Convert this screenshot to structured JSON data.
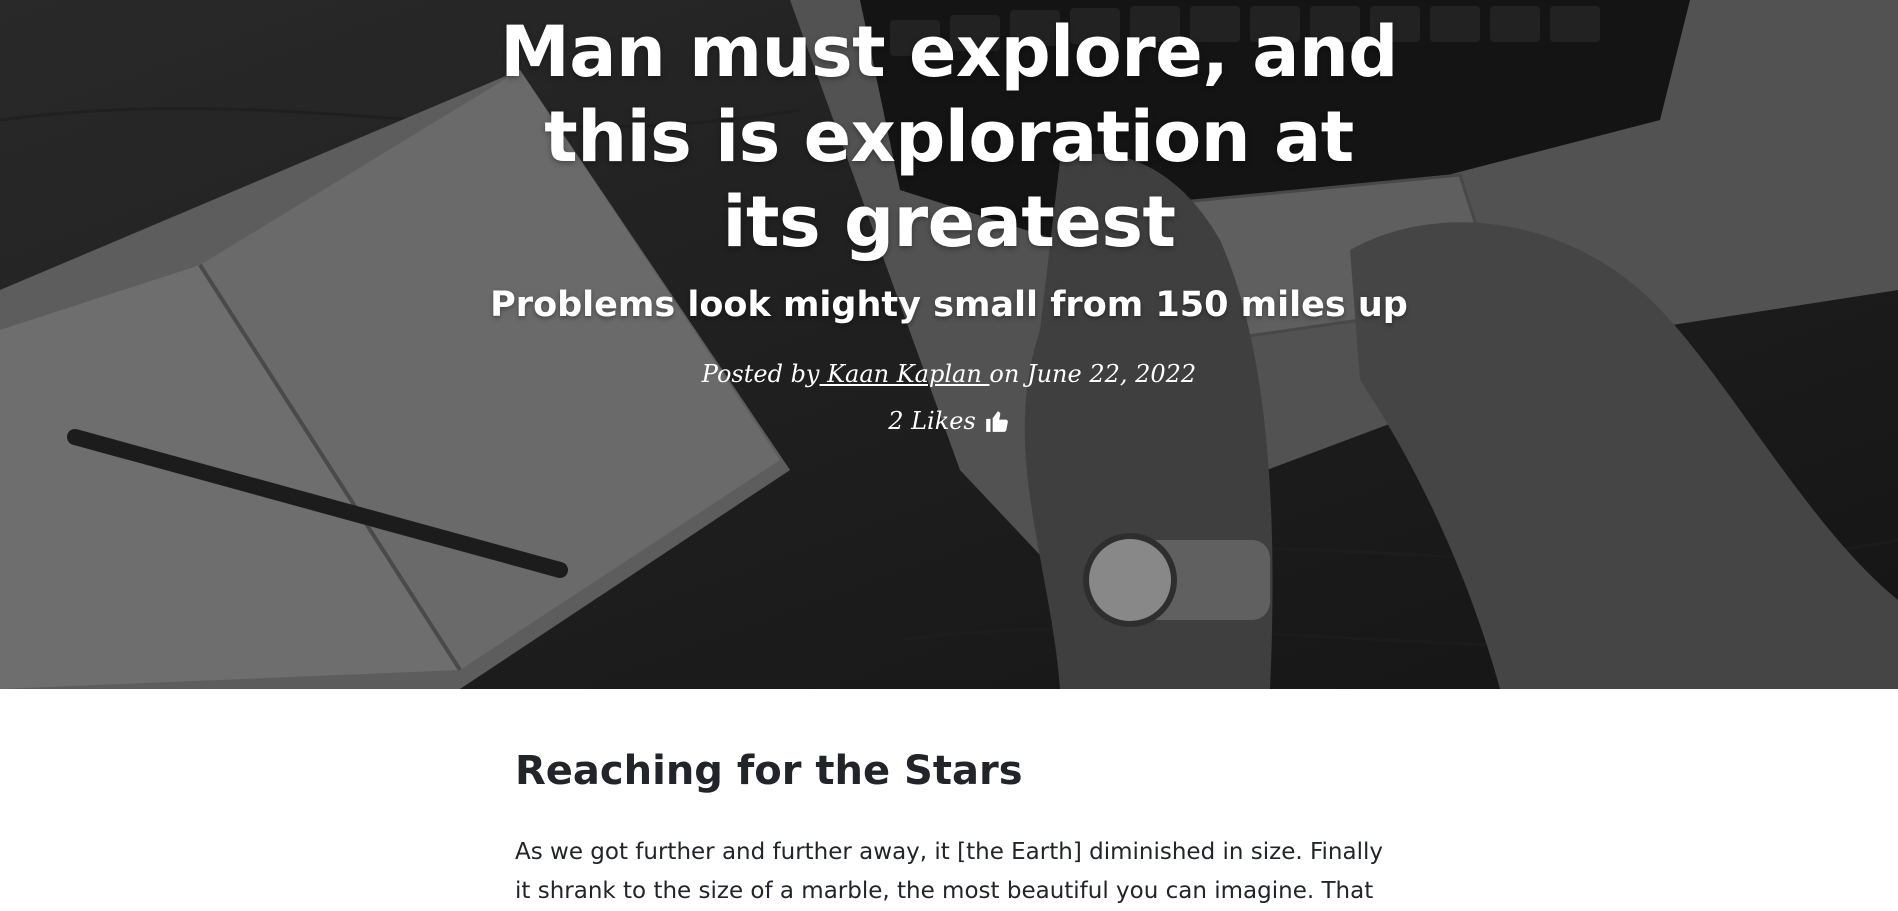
{
  "hero": {
    "title": "Man must explore, and this is exploration at its greatest",
    "subtitle": "Problems look mighty small from 150 miles up",
    "meta_prefix": "Posted by",
    "author": " Kaan Kaplan ",
    "meta_suffix": "on June 22, 2022",
    "likes_label": "2 Likes",
    "like_icon": "thumbs-up-icon"
  },
  "article": {
    "heading": "Reaching for the Stars",
    "paragraph": "As we got further and further away, it [the Earth] diminished in size. Finally it shrank to the size of a marble, the most beautiful you can imagine. That"
  }
}
